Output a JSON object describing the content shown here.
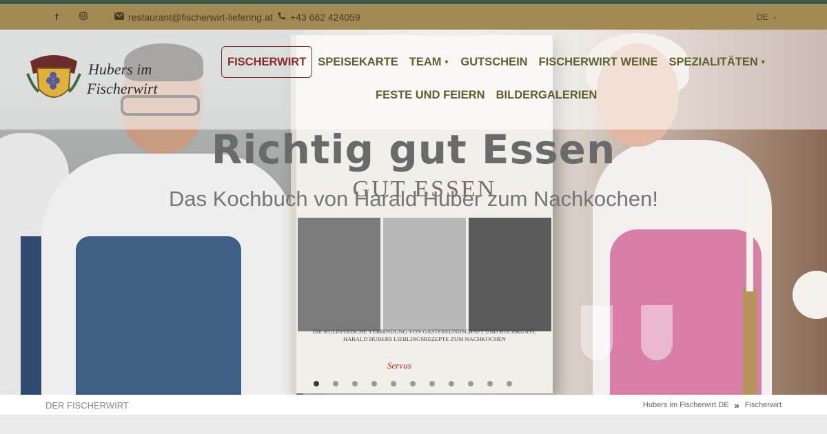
{
  "topbar": {
    "facebook_icon": "facebook-icon",
    "instagram_icon": "instagram-icon",
    "email": "restaurant@fischerwirt-liefering.at",
    "phone": "+43 662 424059",
    "language": "DE"
  },
  "brand": {
    "name_line1": "Hubers im",
    "name_line2": "Fischerwirt"
  },
  "nav": {
    "items": [
      {
        "label": "FISCHERWIRT",
        "active": true
      },
      {
        "label": "SPEISEKARTE"
      },
      {
        "label": "TEAM",
        "dropdown": true
      },
      {
        "label": "GUTSCHEIN"
      },
      {
        "label": "FISCHERWIRT WEINE"
      },
      {
        "label": "SPEZIALITÄTEN",
        "dropdown": true
      },
      {
        "label": "FESTE UND FEIERN"
      },
      {
        "label": "BILDERGALERIEN"
      }
    ]
  },
  "hero": {
    "title": "Richtig gut Essen",
    "subtitle": "Das Kochbuch von Harald Huber zum Nachkochen!",
    "book_title": "GUT ESSEN",
    "book_subtitle_line1": "DIE KULINARISCHE VERBINDUNG VON GASTFREUNDSCHAFT UND KOCHKUNST.",
    "book_subtitle_line2": "HARALD HUBERS LIEBLINGSREZEPTE ZUM NACHKOCHEN",
    "book_publisher": "Servus",
    "slide_count": 11,
    "active_slide": 1
  },
  "breadcrumb": {
    "page_label": "DER FISCHERWIRT",
    "items": [
      "Hubers im Fischerwirt DE",
      "Fischerwirt"
    ],
    "separator": "»"
  },
  "colors": {
    "topbar": "#a28a55",
    "accent_stripe": "#3f5a4a",
    "nav_text": "#5e5e2f",
    "nav_active": "#8b2b2b"
  }
}
